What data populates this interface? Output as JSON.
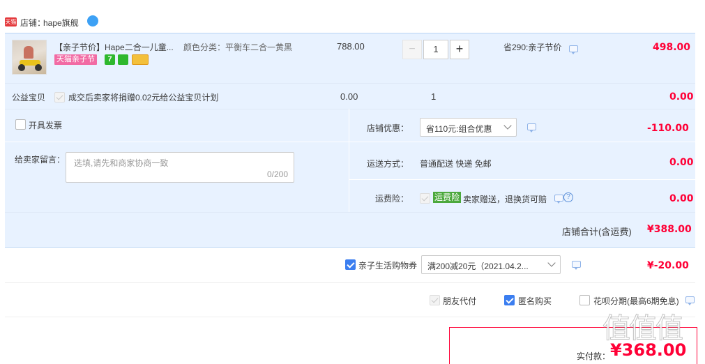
{
  "shop": {
    "badge": "天猫",
    "label": "店铺：",
    "name": "hape旗舰"
  },
  "item": {
    "title": "【亲子节价】Hape二合一儿童...",
    "color_label": "颜色分类：",
    "color_value": "平衡车二合一黄黑",
    "promo_tag": "天猫亲子节",
    "tag_7": "7",
    "price": "788.00",
    "quantity": "1",
    "discount_note": "省290:亲子节价",
    "total": "498.00"
  },
  "charity": {
    "label": "公益宝贝",
    "text": "成交后卖家将捐赠0.02元给公益宝贝计划",
    "price": "0.00",
    "quantity": "1",
    "total": "0.00"
  },
  "invoice": {
    "label": "开具发票"
  },
  "message": {
    "label": "给卖家留言：",
    "placeholder": "选填,请先和商家协商一致",
    "counter": "0/200"
  },
  "shop_discount": {
    "label": "店铺优惠：",
    "selected": "省110元:组合优惠",
    "amount": "-110.00"
  },
  "shipping": {
    "label": "运送方式：",
    "value": "普通配送 快递 免邮",
    "amount": "0.00"
  },
  "insurance": {
    "label": "运费险：",
    "tag": "运费险",
    "text": "卖家赠送，退换货可赔",
    "amount": "0.00"
  },
  "shop_total": {
    "label": "店铺合计(含运费)",
    "amount": "¥388.00"
  },
  "coupon": {
    "label": "亲子生活购物券",
    "selected": "满200减20元（2021.04.2...",
    "amount": "¥-20.00"
  },
  "options": {
    "friend_pay": "朋友代付",
    "anonymous": "匿名购买",
    "huabei": "花呗分期(最高6期免息)"
  },
  "payment": {
    "label": "实付款：",
    "amount": "¥368.00"
  },
  "watermark": "值值值",
  "colors": {
    "accent_red": "#ff0036",
    "section_blue": "#e8f2ff",
    "check_blue": "#3b7ef0"
  }
}
